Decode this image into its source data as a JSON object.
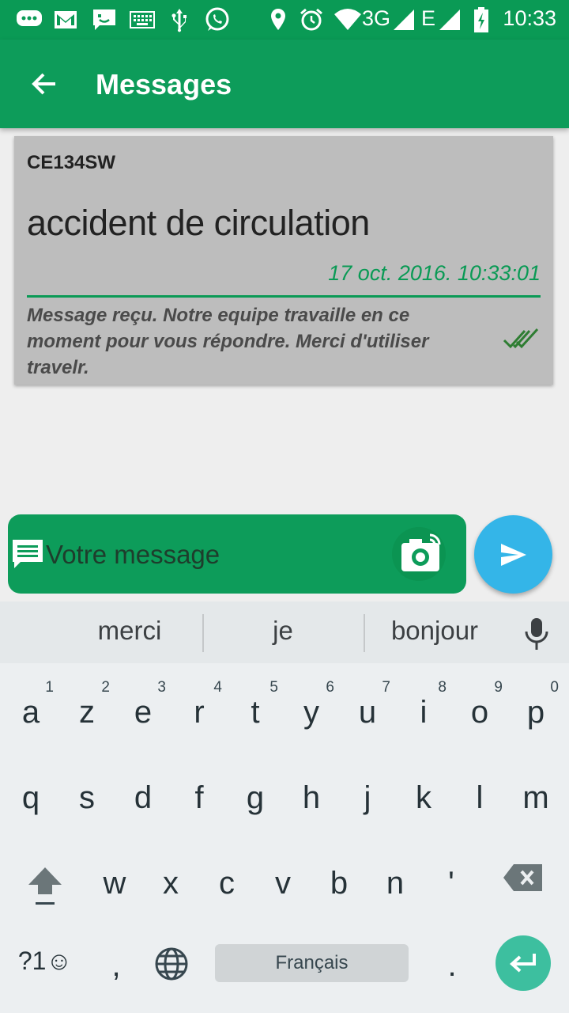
{
  "status_bar": {
    "network_3g": "3G",
    "network_e": "E",
    "time": "10:33"
  },
  "app_bar": {
    "title": "Messages"
  },
  "message_card": {
    "plate": "CE134SW",
    "message": "accident de circulation",
    "date": "17 oct. 2016. 10:33:01",
    "reply": "Message reçu. Notre equipe travaille en ce moment pour vous répondre. Merci d'utiliser travelr.",
    "accent_color": "#0a9a55"
  },
  "composer": {
    "placeholder": "Votre message"
  },
  "keyboard": {
    "suggestions": [
      "merci",
      "je",
      "bonjour"
    ],
    "row1": [
      {
        "char": "a",
        "hint": "1"
      },
      {
        "char": "z",
        "hint": "2"
      },
      {
        "char": "e",
        "hint": "3"
      },
      {
        "char": "r",
        "hint": "4"
      },
      {
        "char": "t",
        "hint": "5"
      },
      {
        "char": "y",
        "hint": "6"
      },
      {
        "char": "u",
        "hint": "7"
      },
      {
        "char": "i",
        "hint": "8"
      },
      {
        "char": "o",
        "hint": "9"
      },
      {
        "char": "p",
        "hint": "0"
      }
    ],
    "row2": [
      "q",
      "s",
      "d",
      "f",
      "g",
      "h",
      "j",
      "k",
      "l",
      "m"
    ],
    "row3": [
      "w",
      "x",
      "c",
      "v",
      "b",
      "n",
      "'"
    ],
    "symbols_label": "?1☺",
    "comma": ",",
    "space_label": "Français",
    "period": "."
  },
  "colors": {
    "app_green": "#0d9c5a",
    "send_blue": "#34b5e8",
    "enter_teal": "#3dbf9f"
  }
}
